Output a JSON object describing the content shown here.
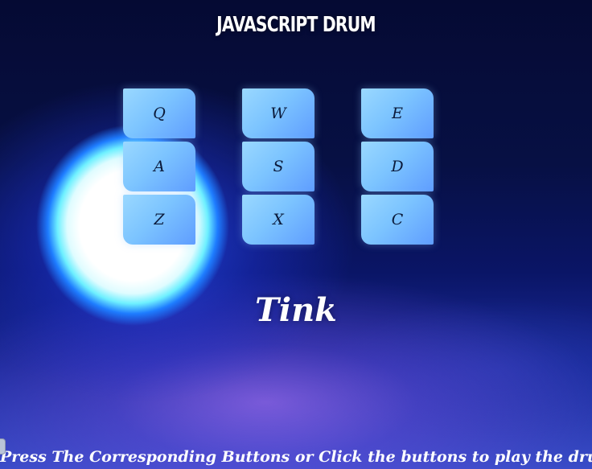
{
  "header": {
    "title": "JAVASCRIPT DRUM"
  },
  "pads": [
    {
      "key": "Q"
    },
    {
      "key": "W"
    },
    {
      "key": "E"
    },
    {
      "key": "A"
    },
    {
      "key": "S"
    },
    {
      "key": "D"
    },
    {
      "key": "Z"
    },
    {
      "key": "X"
    },
    {
      "key": "C"
    }
  ],
  "display": {
    "sound": "Tink"
  },
  "footer": {
    "instructions": "Press The Corresponding Buttons or Click the buttons to play the drum"
  },
  "colors": {
    "pad": "#7cc4ff",
    "pad_text": "#0b1a3a",
    "text": "#ffffff",
    "background": "#071044"
  }
}
